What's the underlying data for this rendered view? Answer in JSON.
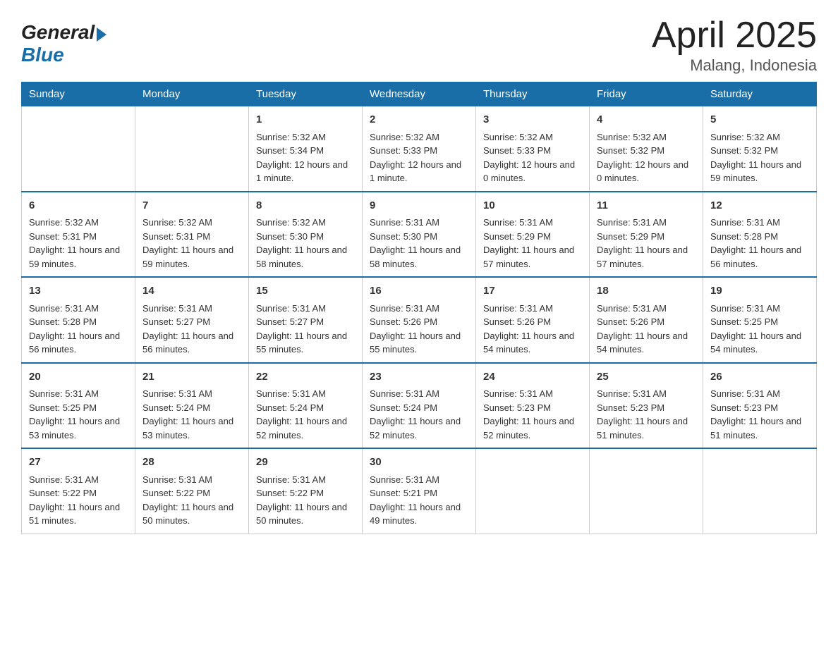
{
  "header": {
    "logo_general": "General",
    "logo_blue": "Blue",
    "month_title": "April 2025",
    "location": "Malang, Indonesia"
  },
  "weekdays": [
    "Sunday",
    "Monday",
    "Tuesday",
    "Wednesday",
    "Thursday",
    "Friday",
    "Saturday"
  ],
  "weeks": [
    [
      null,
      null,
      {
        "day": "1",
        "sunrise": "Sunrise: 5:32 AM",
        "sunset": "Sunset: 5:34 PM",
        "daylight": "Daylight: 12 hours and 1 minute."
      },
      {
        "day": "2",
        "sunrise": "Sunrise: 5:32 AM",
        "sunset": "Sunset: 5:33 PM",
        "daylight": "Daylight: 12 hours and 1 minute."
      },
      {
        "day": "3",
        "sunrise": "Sunrise: 5:32 AM",
        "sunset": "Sunset: 5:33 PM",
        "daylight": "Daylight: 12 hours and 0 minutes."
      },
      {
        "day": "4",
        "sunrise": "Sunrise: 5:32 AM",
        "sunset": "Sunset: 5:32 PM",
        "daylight": "Daylight: 12 hours and 0 minutes."
      },
      {
        "day": "5",
        "sunrise": "Sunrise: 5:32 AM",
        "sunset": "Sunset: 5:32 PM",
        "daylight": "Daylight: 11 hours and 59 minutes."
      }
    ],
    [
      {
        "day": "6",
        "sunrise": "Sunrise: 5:32 AM",
        "sunset": "Sunset: 5:31 PM",
        "daylight": "Daylight: 11 hours and 59 minutes."
      },
      {
        "day": "7",
        "sunrise": "Sunrise: 5:32 AM",
        "sunset": "Sunset: 5:31 PM",
        "daylight": "Daylight: 11 hours and 59 minutes."
      },
      {
        "day": "8",
        "sunrise": "Sunrise: 5:32 AM",
        "sunset": "Sunset: 5:30 PM",
        "daylight": "Daylight: 11 hours and 58 minutes."
      },
      {
        "day": "9",
        "sunrise": "Sunrise: 5:31 AM",
        "sunset": "Sunset: 5:30 PM",
        "daylight": "Daylight: 11 hours and 58 minutes."
      },
      {
        "day": "10",
        "sunrise": "Sunrise: 5:31 AM",
        "sunset": "Sunset: 5:29 PM",
        "daylight": "Daylight: 11 hours and 57 minutes."
      },
      {
        "day": "11",
        "sunrise": "Sunrise: 5:31 AM",
        "sunset": "Sunset: 5:29 PM",
        "daylight": "Daylight: 11 hours and 57 minutes."
      },
      {
        "day": "12",
        "sunrise": "Sunrise: 5:31 AM",
        "sunset": "Sunset: 5:28 PM",
        "daylight": "Daylight: 11 hours and 56 minutes."
      }
    ],
    [
      {
        "day": "13",
        "sunrise": "Sunrise: 5:31 AM",
        "sunset": "Sunset: 5:28 PM",
        "daylight": "Daylight: 11 hours and 56 minutes."
      },
      {
        "day": "14",
        "sunrise": "Sunrise: 5:31 AM",
        "sunset": "Sunset: 5:27 PM",
        "daylight": "Daylight: 11 hours and 56 minutes."
      },
      {
        "day": "15",
        "sunrise": "Sunrise: 5:31 AM",
        "sunset": "Sunset: 5:27 PM",
        "daylight": "Daylight: 11 hours and 55 minutes."
      },
      {
        "day": "16",
        "sunrise": "Sunrise: 5:31 AM",
        "sunset": "Sunset: 5:26 PM",
        "daylight": "Daylight: 11 hours and 55 minutes."
      },
      {
        "day": "17",
        "sunrise": "Sunrise: 5:31 AM",
        "sunset": "Sunset: 5:26 PM",
        "daylight": "Daylight: 11 hours and 54 minutes."
      },
      {
        "day": "18",
        "sunrise": "Sunrise: 5:31 AM",
        "sunset": "Sunset: 5:26 PM",
        "daylight": "Daylight: 11 hours and 54 minutes."
      },
      {
        "day": "19",
        "sunrise": "Sunrise: 5:31 AM",
        "sunset": "Sunset: 5:25 PM",
        "daylight": "Daylight: 11 hours and 54 minutes."
      }
    ],
    [
      {
        "day": "20",
        "sunrise": "Sunrise: 5:31 AM",
        "sunset": "Sunset: 5:25 PM",
        "daylight": "Daylight: 11 hours and 53 minutes."
      },
      {
        "day": "21",
        "sunrise": "Sunrise: 5:31 AM",
        "sunset": "Sunset: 5:24 PM",
        "daylight": "Daylight: 11 hours and 53 minutes."
      },
      {
        "day": "22",
        "sunrise": "Sunrise: 5:31 AM",
        "sunset": "Sunset: 5:24 PM",
        "daylight": "Daylight: 11 hours and 52 minutes."
      },
      {
        "day": "23",
        "sunrise": "Sunrise: 5:31 AM",
        "sunset": "Sunset: 5:24 PM",
        "daylight": "Daylight: 11 hours and 52 minutes."
      },
      {
        "day": "24",
        "sunrise": "Sunrise: 5:31 AM",
        "sunset": "Sunset: 5:23 PM",
        "daylight": "Daylight: 11 hours and 52 minutes."
      },
      {
        "day": "25",
        "sunrise": "Sunrise: 5:31 AM",
        "sunset": "Sunset: 5:23 PM",
        "daylight": "Daylight: 11 hours and 51 minutes."
      },
      {
        "day": "26",
        "sunrise": "Sunrise: 5:31 AM",
        "sunset": "Sunset: 5:23 PM",
        "daylight": "Daylight: 11 hours and 51 minutes."
      }
    ],
    [
      {
        "day": "27",
        "sunrise": "Sunrise: 5:31 AM",
        "sunset": "Sunset: 5:22 PM",
        "daylight": "Daylight: 11 hours and 51 minutes."
      },
      {
        "day": "28",
        "sunrise": "Sunrise: 5:31 AM",
        "sunset": "Sunset: 5:22 PM",
        "daylight": "Daylight: 11 hours and 50 minutes."
      },
      {
        "day": "29",
        "sunrise": "Sunrise: 5:31 AM",
        "sunset": "Sunset: 5:22 PM",
        "daylight": "Daylight: 11 hours and 50 minutes."
      },
      {
        "day": "30",
        "sunrise": "Sunrise: 5:31 AM",
        "sunset": "Sunset: 5:21 PM",
        "daylight": "Daylight: 11 hours and 49 minutes."
      },
      null,
      null,
      null
    ]
  ]
}
